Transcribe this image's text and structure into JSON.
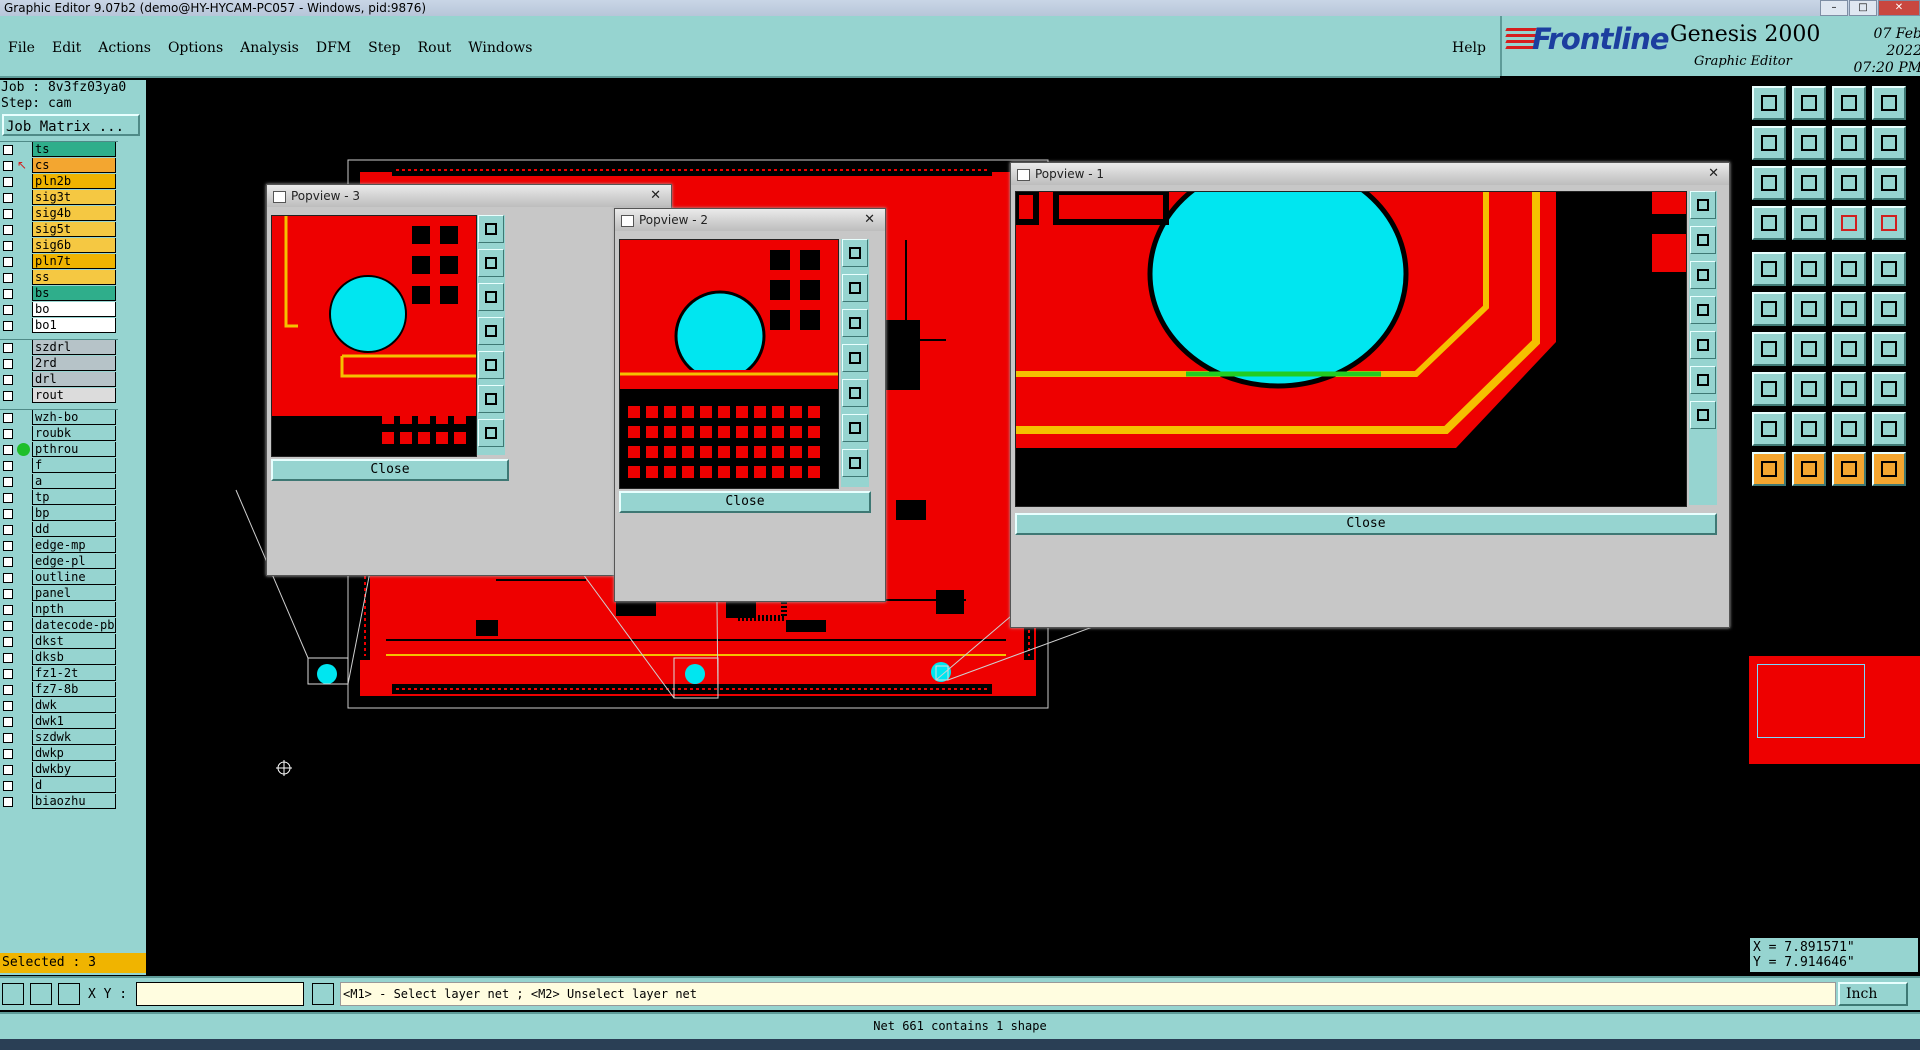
{
  "window": {
    "title": "Graphic Editor 9.07b2 (demo@HY-HYCAM-PC057 - Windows, pid:9876)"
  },
  "menu": {
    "items": [
      "File",
      "Edit",
      "Actions",
      "Options",
      "Analysis",
      "DFM",
      "Step",
      "Rout",
      "Windows"
    ],
    "help": "Help"
  },
  "brand": {
    "company": "Frontline",
    "product": "Genesis 2000",
    "subtitle": "Graphic Editor",
    "date": "07 Feb 2022",
    "time": "07:20 PM"
  },
  "job": {
    "job_line": "Job : 8v3fz03ya0",
    "step_line": "Step: cam",
    "matrix_button": "Job Matrix ..."
  },
  "layers": {
    "board": [
      {
        "name": "ts",
        "color": "#2fae8b"
      },
      {
        "name": "cs",
        "color": "#f3a630"
      },
      {
        "name": "pln2b",
        "color": "#f0b400"
      },
      {
        "name": "sig3t",
        "color": "#f5c842"
      },
      {
        "name": "sig4b",
        "color": "#f5c842"
      },
      {
        "name": "sig5t",
        "color": "#f5c842"
      },
      {
        "name": "sig6b",
        "color": "#f5c842"
      },
      {
        "name": "pln7t",
        "color": "#f0b400"
      },
      {
        "name": "ss",
        "color": "#f5c842"
      },
      {
        "name": "bs",
        "color": "#2fae8b"
      },
      {
        "name": "bo",
        "color": "#ffffff"
      },
      {
        "name": "bo1",
        "color": "#ffffff"
      }
    ],
    "drill": [
      {
        "name": "szdrl",
        "color": "#b6c3c8"
      },
      {
        "name": "2rd",
        "color": "#b6c3c8"
      },
      {
        "name": "drl",
        "color": "#b6c3c8"
      },
      {
        "name": "rout",
        "color": "#dcdcdc"
      }
    ],
    "misc": [
      {
        "name": "wzh-bo",
        "color": "#96d4d0"
      },
      {
        "name": "roubk",
        "color": "#96d4d0"
      },
      {
        "name": "pthrou",
        "color": "#96d4d0"
      },
      {
        "name": "f",
        "color": "#96d4d0"
      },
      {
        "name": "a",
        "color": "#96d4d0"
      },
      {
        "name": "tp",
        "color": "#96d4d0"
      },
      {
        "name": "bp",
        "color": "#96d4d0"
      },
      {
        "name": "dd",
        "color": "#96d4d0"
      },
      {
        "name": "edge-mp",
        "color": "#96d4d0"
      },
      {
        "name": "edge-pl",
        "color": "#96d4d0"
      },
      {
        "name": "outline",
        "color": "#96d4d0"
      },
      {
        "name": "panel",
        "color": "#96d4d0"
      },
      {
        "name": "npth",
        "color": "#96d4d0"
      },
      {
        "name": "datecode-pbe",
        "color": "#96d4d0"
      },
      {
        "name": "dkst",
        "color": "#96d4d0"
      },
      {
        "name": "dksb",
        "color": "#96d4d0"
      },
      {
        "name": "fz1-2t",
        "color": "#96d4d0"
      },
      {
        "name": "fz7-8b",
        "color": "#96d4d0"
      },
      {
        "name": "dwk",
        "color": "#96d4d0"
      },
      {
        "name": "dwk1",
        "color": "#96d4d0"
      },
      {
        "name": "szdwk",
        "color": "#96d4d0"
      },
      {
        "name": "dwkp",
        "color": "#96d4d0"
      },
      {
        "name": "dwkby",
        "color": "#96d4d0"
      },
      {
        "name": "d",
        "color": "#96d4d0"
      },
      {
        "name": "biaozhu",
        "color": "#96d4d0"
      }
    ],
    "selected": "Selected : 3"
  },
  "popups": {
    "p3": {
      "title": "Popview - 3",
      "close": "Close"
    },
    "p2": {
      "title": "Popview - 2",
      "close": "Close"
    },
    "p1": {
      "title": "Popview - 1",
      "close": "Close"
    }
  },
  "coords": {
    "x": "X = 7.891571\"",
    "y": "Y = 7.914646\""
  },
  "bottom": {
    "xy_label": "X Y :",
    "xy_value": "",
    "prompt": "<M1> - Select layer net ; <M2> Unselect layer net",
    "units": "Inch"
  },
  "status": {
    "message": "Net 661 contains 1 shape"
  },
  "colors": {
    "copper": "#ee0000",
    "pad": "#00e6f0",
    "trace": "#f5c000",
    "ui": "#96d4d0"
  }
}
